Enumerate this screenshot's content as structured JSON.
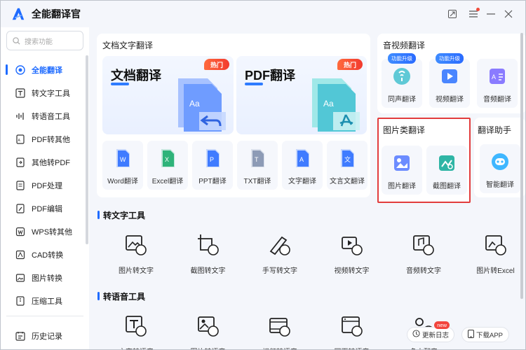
{
  "app": {
    "title": "全能翻译官"
  },
  "sidebar": {
    "search_placeholder": "搜索功能",
    "items": [
      {
        "label": "全能翻译",
        "icon": "translate-icon",
        "active": true
      },
      {
        "label": "转文字工具",
        "icon": "text-tool-icon"
      },
      {
        "label": "转语音工具",
        "icon": "voice-tool-icon"
      },
      {
        "label": "PDF转其他",
        "icon": "pdf-convert-icon"
      },
      {
        "label": "其他转PDF",
        "icon": "to-pdf-icon"
      },
      {
        "label": "PDF处理",
        "icon": "pdf-process-icon"
      },
      {
        "label": "PDF编辑",
        "icon": "pdf-edit-icon"
      },
      {
        "label": "WPS转其他",
        "icon": "wps-icon"
      },
      {
        "label": "CAD转换",
        "icon": "cad-icon"
      },
      {
        "label": "图片转换",
        "icon": "image-convert-icon"
      },
      {
        "label": "压缩工具",
        "icon": "compress-icon"
      }
    ],
    "history": {
      "label": "历史记录",
      "icon": "history-icon"
    }
  },
  "doc_section": {
    "title": "文档文字翻译",
    "big_cards": [
      {
        "label": "文档翻译",
        "badge": "热门"
      },
      {
        "label": "PDF翻译",
        "badge": "热门"
      }
    ],
    "tiles": [
      "Word翻译",
      "Excel翻译",
      "PPT翻译",
      "TXT翻译",
      "文字翻译",
      "文言文翻译"
    ]
  },
  "av_section": {
    "title": "音视频翻译",
    "tiles": [
      {
        "label": "同声翻译",
        "badge": "功能升级"
      },
      {
        "label": "视频翻译",
        "badge": "功能升级"
      },
      {
        "label": "音频翻译",
        "badge": ""
      }
    ]
  },
  "image_section": {
    "title": "图片类翻译",
    "tiles": [
      "图片翻译",
      "截图翻译"
    ]
  },
  "assistant_section": {
    "title": "翻译助手",
    "tiles": [
      "智能翻译"
    ]
  },
  "text_tools": {
    "title": "转文字工具",
    "items": [
      "图片转文字",
      "截图转文字",
      "手写转文字",
      "视频转文字",
      "音频转文字",
      "图片转Excel"
    ]
  },
  "voice_tools": {
    "title": "转语音工具",
    "items": [
      "文字转语音",
      "图片转语音",
      "视频转语音",
      "网页转语音",
      "多人配音"
    ]
  },
  "float": {
    "changelog": "更新日志",
    "changelog_badge": "new",
    "download": "下载APP"
  },
  "colors": {
    "accent": "#1e6bff",
    "hot": "#f23b2e",
    "highlight": "#e23c3c"
  }
}
